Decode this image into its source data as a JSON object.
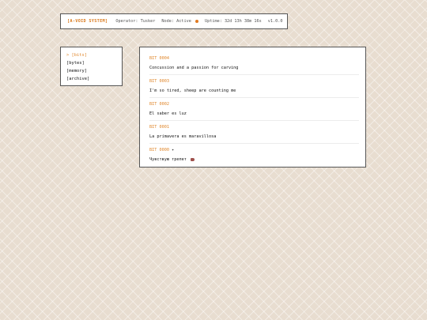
{
  "header": {
    "brand": "[A-VOID SYSTEM]",
    "operator": "Operator: Tusker",
    "node": "Node: Active",
    "uptime": "Uptime: 32d 13h 38m 16s",
    "version": "v1.0.0"
  },
  "sidebar": {
    "items": [
      {
        "label": "> [bits]",
        "active": true
      },
      {
        "label": "[bytes]"
      },
      {
        "label": "[memory]"
      },
      {
        "label": "[archive]"
      }
    ]
  },
  "bits": [
    {
      "id": "BIT 0004",
      "text": "Concussion and a passion for carving"
    },
    {
      "id": "BIT 0003",
      "text": "I'm so tired, sheep are counting me"
    },
    {
      "id": "BIT 0002",
      "text": "El saber es luz"
    },
    {
      "id": "BIT 0001",
      "text": "La primavera es maravillosa"
    },
    {
      "id": "BIT 0000",
      "pin": "✦",
      "text": "Чувствую трепет",
      "emoji": "heart-icon"
    }
  ],
  "colors": {
    "accent": "#e0862a",
    "background": "#e8ddd0",
    "panel": "#ffffff",
    "border": "#555555"
  }
}
